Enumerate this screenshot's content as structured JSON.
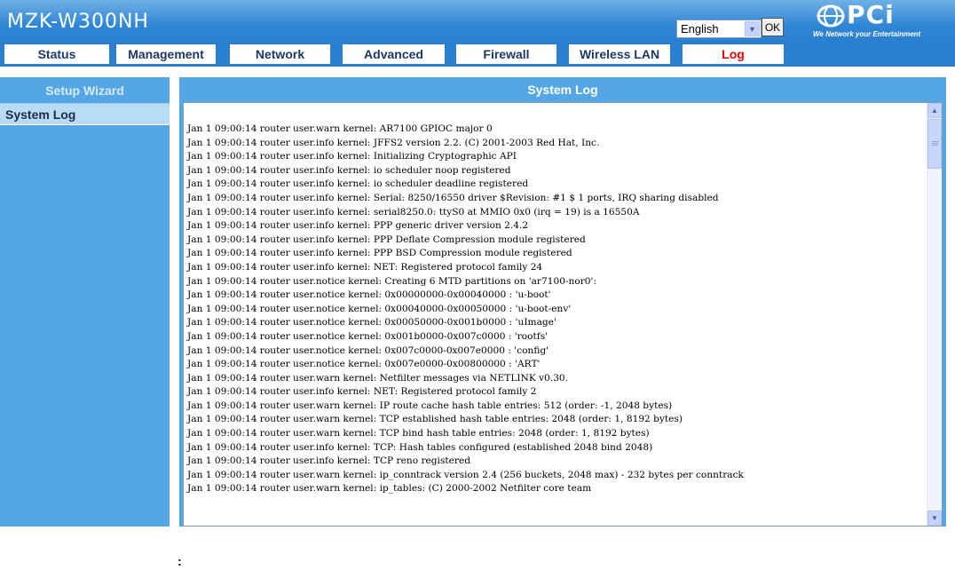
{
  "header": {
    "product_title": "MZK-W300NH",
    "language_selected": "English",
    "ok_label": "OK",
    "logo_text": "PCi",
    "logo_tagline": "We Network your Entertainment",
    "brand_color": "#2a7fcf"
  },
  "nav": {
    "tabs": [
      {
        "label": "Status"
      },
      {
        "label": "Management"
      },
      {
        "label": "Network"
      },
      {
        "label": "Advanced"
      },
      {
        "label": "Firewall"
      },
      {
        "label": "Wireless LAN"
      },
      {
        "label": "Log",
        "active": true
      }
    ]
  },
  "sidebar": {
    "header": "Setup Wizard",
    "items": [
      {
        "label": "System Log"
      }
    ]
  },
  "main": {
    "title": "System Log",
    "log_lines": [
      "Jan 1 09:00:14 router user.warn kernel: AR7100 GPIOC major 0",
      "Jan 1 09:00:14 router user.info kernel: JFFS2 version 2.2. (C) 2001-2003 Red Hat, Inc.",
      "Jan 1 09:00:14 router user.info kernel: Initializing Cryptographic API",
      "Jan 1 09:00:14 router user.info kernel: io scheduler noop registered",
      "Jan 1 09:00:14 router user.info kernel: io scheduler deadline registered",
      "Jan 1 09:00:14 router user.info kernel: Serial: 8250/16550 driver $Revision: #1 $ 1 ports, IRQ sharing disabled",
      "Jan 1 09:00:14 router user.info kernel: serial8250.0: ttyS0 at MMIO 0x0 (irq = 19) is a 16550A",
      "Jan 1 09:00:14 router user.info kernel: PPP generic driver version 2.4.2",
      "Jan 1 09:00:14 router user.info kernel: PPP Deflate Compression module registered",
      "Jan 1 09:00:14 router user.info kernel: PPP BSD Compression module registered",
      "Jan 1 09:00:14 router user.info kernel: NET: Registered protocol family 24",
      "Jan 1 09:00:14 router user.notice kernel: Creating 6 MTD partitions on 'ar7100-nor0':",
      "Jan 1 09:00:14 router user.notice kernel: 0x00000000-0x00040000 : 'u-boot'",
      "Jan 1 09:00:14 router user.notice kernel: 0x00040000-0x00050000 : 'u-boot-env'",
      "Jan 1 09:00:14 router user.notice kernel: 0x00050000-0x001b0000 : 'uImage'",
      "Jan 1 09:00:14 router user.notice kernel: 0x001b0000-0x007c0000 : 'rootfs'",
      "Jan 1 09:00:14 router user.notice kernel: 0x007c0000-0x007e0000 : 'config'",
      "Jan 1 09:00:14 router user.notice kernel: 0x007e0000-0x00800000 : 'ART'",
      "Jan 1 09:00:14 router user.warn kernel: Netfilter messages via NETLINK v0.30.",
      "Jan 1 09:00:14 router user.info kernel: NET: Registered protocol family 2",
      "Jan 1 09:00:14 router user.warn kernel: IP route cache hash table entries: 512 (order: -1, 2048 bytes)",
      "Jan 1 09:00:14 router user.warn kernel: TCP established hash table entries: 2048 (order: 1, 8192 bytes)",
      "Jan 1 09:00:14 router user.warn kernel: TCP bind hash table entries: 2048 (order: 1, 8192 bytes)",
      "Jan 1 09:00:14 router user.info kernel: TCP: Hash tables configured (established 2048 bind 2048)",
      "Jan 1 09:00:14 router user.info kernel: TCP reno registered",
      "Jan 1 09:00:14 router user.warn kernel: ip_conntrack version 2.4 (256 buckets, 2048 max) - 232 bytes per conntrack",
      "Jan 1 09:00:14 router user.warn kernel: ip_tables: (C) 2000-2002 Netfilter core team"
    ]
  },
  "footer": {
    "mark": ":"
  }
}
